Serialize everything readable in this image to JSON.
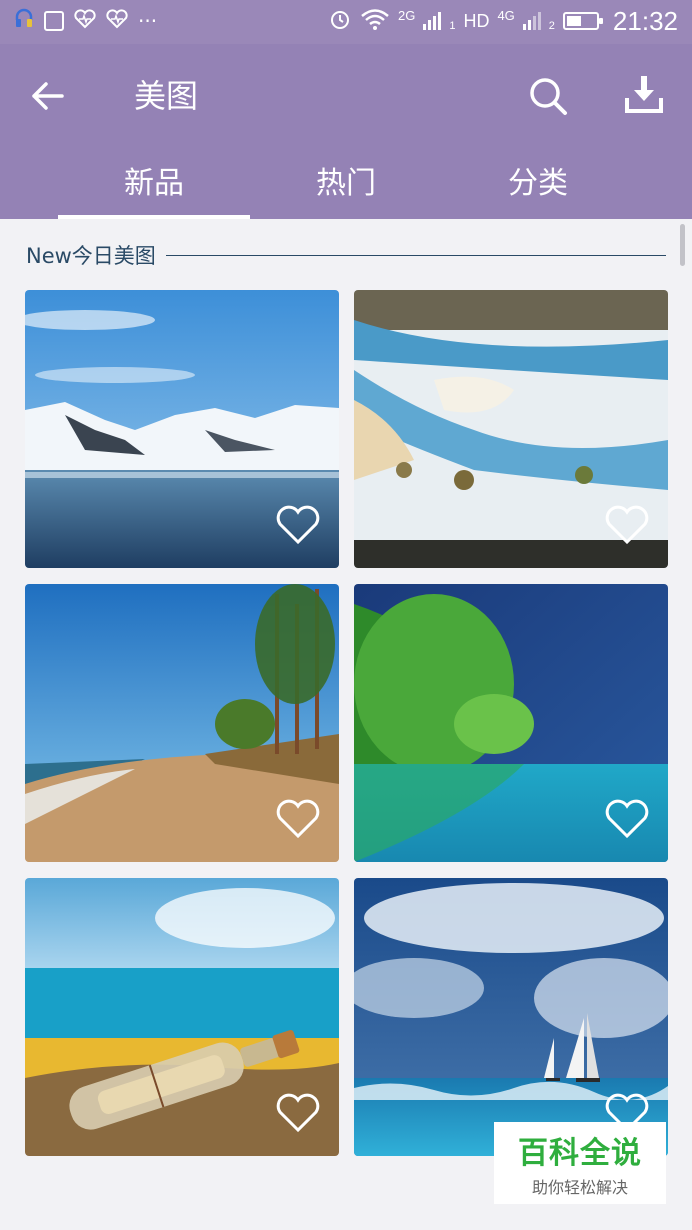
{
  "status_bar": {
    "network_2g": "2G",
    "network_hd": "HD",
    "network_4g": "4G",
    "sim1": "1",
    "sim2": "2",
    "time": "21:32",
    "more": "···",
    "battery_level": 0.45
  },
  "app_bar": {
    "title": "美图",
    "tabs": [
      {
        "label": "新品",
        "selected": true
      },
      {
        "label": "热门",
        "selected": false
      },
      {
        "label": "分类",
        "selected": false
      }
    ]
  },
  "section": {
    "title": "New今日美图"
  },
  "images": [
    {
      "subject": "snowy mountains lake",
      "favorited": false
    },
    {
      "subject": "aerial snowy river",
      "favorited": false
    },
    {
      "subject": "beach with pine trees",
      "favorited": false
    },
    {
      "subject": "green trees turquoise lake",
      "favorited": false
    },
    {
      "subject": "message bottle on sand",
      "favorited": false
    },
    {
      "subject": "sailboats on stormy sea",
      "favorited": false
    }
  ],
  "watermark": {
    "title": "百科全说",
    "subtitle": "助你轻松解决"
  },
  "colors": {
    "app_bar": "#9482b5",
    "status_bar": "#9a88b8",
    "section_text": "#2a4a66",
    "background": "#f2f2f5",
    "watermark_green": "#2fae3e"
  }
}
